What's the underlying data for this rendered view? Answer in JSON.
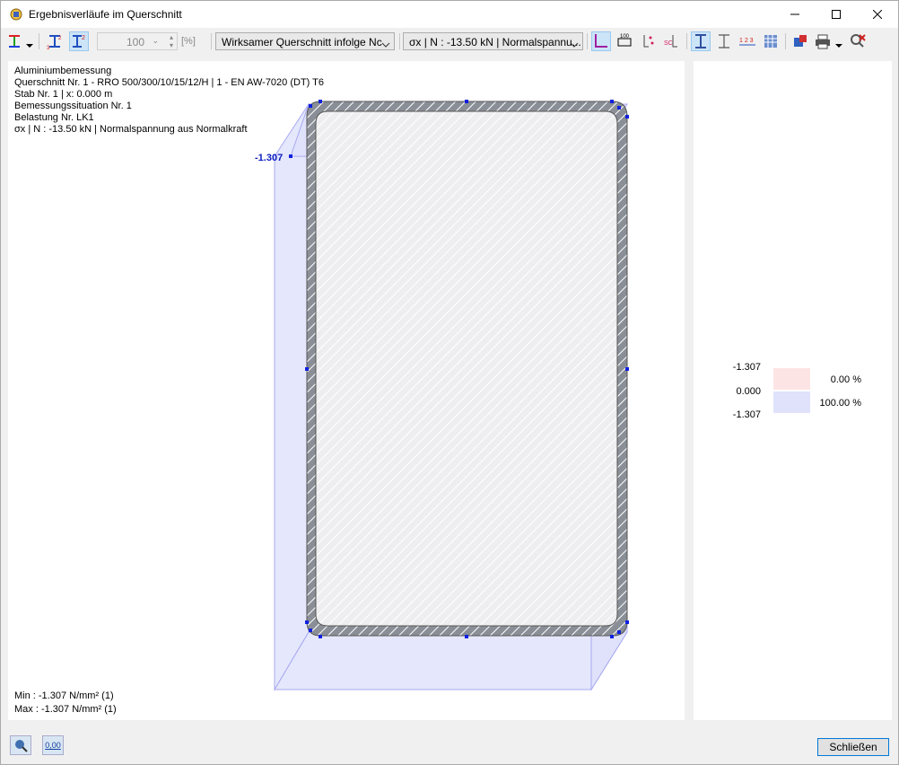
{
  "window": {
    "title": "Ergebnisverläufe im Querschnitt"
  },
  "toolbar": {
    "zoom_value": "100",
    "zoom_unit": "[%]",
    "combo_section": "Wirksamer Querschnitt infolge Nc",
    "combo_result": "σx | N : -13.50 kN | Normalspannu..."
  },
  "info": {
    "line1": "Aluminiumbemessung",
    "line2": "Querschnitt Nr. 1 - RRO 500/300/10/15/12/H | 1 - EN AW-7020 (DT) T6",
    "line3": "Stab Nr. 1 | x: 0.000 m",
    "line4": "Bemessungssituation Nr. 1",
    "line5": "Belastung Nr. LK1",
    "line6": "σx | N : -13.50 kN | Normalspannung aus Normalkraft"
  },
  "diagram": {
    "value_label": "-1.307"
  },
  "minmax": {
    "min": "Min : -1.307 N/mm² (1)",
    "max": "Max : -1.307 N/mm² (1)"
  },
  "legend": {
    "values": [
      "-1.307",
      "0.000",
      "-1.307"
    ],
    "percents": [
      "0.00 %",
      "100.00 %"
    ],
    "colors": {
      "positive": "#fde4e4",
      "negative": "#e0e2fb"
    }
  },
  "buttons": {
    "close": "Schließen"
  },
  "status": {
    "decimal_icon_text": "0,00"
  }
}
